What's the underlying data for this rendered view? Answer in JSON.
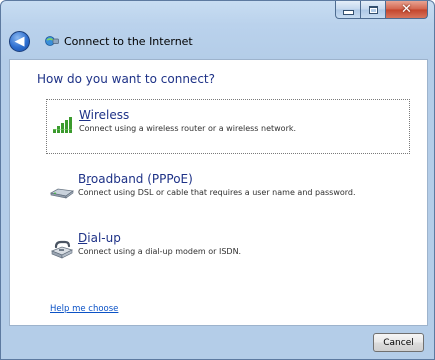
{
  "window": {
    "title": "Connect to the Internet",
    "controls": {
      "minimize": "minimize-icon",
      "maximize": "maximize-icon",
      "close": "close-icon"
    }
  },
  "heading": "How do you want to connect?",
  "options": [
    {
      "title_prefix": "",
      "title_key": "W",
      "title_rest": "ireless",
      "description": "Connect using a wireless router or a wireless network.",
      "icon": "wireless-signal-icon",
      "selected": true
    },
    {
      "title_prefix": "B",
      "title_key": "r",
      "title_rest": "oadband (PPPoE)",
      "description": "Connect using DSL or cable that requires a user name and password.",
      "icon": "broadband-modem-icon",
      "selected": false
    },
    {
      "title_prefix": "",
      "title_key": "D",
      "title_rest": "ial-up",
      "description": "Connect using a dial-up modem or ISDN.",
      "icon": "dialup-modem-icon",
      "selected": false
    }
  ],
  "help_link": "Help me choose",
  "cancel_label": "Cancel",
  "colors": {
    "heading": "#1e3287",
    "link": "#0b52c6",
    "chrome": "#b4cde8"
  }
}
